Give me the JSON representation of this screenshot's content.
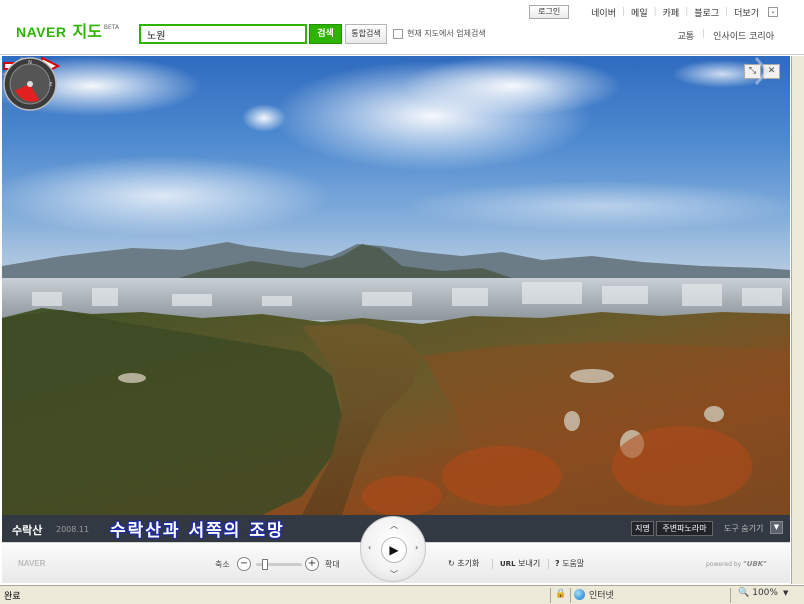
{
  "header": {
    "logo": "NAVER",
    "logo_sub": "지도",
    "logo_badge": "BETA",
    "search_value": "노원",
    "search_button": "검색",
    "unified_search_button": "통합검색",
    "checkbox_label": "현재 지도에서 업체검색",
    "top_nav": {
      "login": "로그인",
      "links": [
        "네이버",
        "메일",
        "카페",
        "블로그",
        "더보기"
      ],
      "more_icon": "chevron-down-icon"
    },
    "sub_nav": [
      "교통",
      "인사이드 코리아"
    ]
  },
  "panorama": {
    "fullscreen_icon": "expand-icon",
    "close_icon": "close-icon",
    "expand_symbol": "⤡",
    "close_symbol": "✕"
  },
  "caption_bar": {
    "place_name": "수락산",
    "place_date": "2008.11",
    "caption": "수락산과 서쪽의 조망",
    "btn_place": "지명",
    "btn_nearby": "주변파노라마",
    "tools": "도구 숨기기"
  },
  "control_bar": {
    "logo": "NAVER",
    "zoom_out": "축소",
    "zoom_in": "확대",
    "zoom_level": 0.15,
    "play_symbol": "▶",
    "reset": "초기화",
    "url_prefix": "URL",
    "url_send": "보내기",
    "help_prefix": "?",
    "help": "도움말",
    "powered_by": "powered by",
    "powered_brand": "\"UBK\""
  },
  "status_bar": {
    "status": "완료",
    "zone": "인터넷",
    "zoom": "100%"
  },
  "colors": {
    "naver_green": "#2db400",
    "caption_bar": "#232a34",
    "caption_outline": "#1d2aa8",
    "arrow_red": "#d90000"
  }
}
